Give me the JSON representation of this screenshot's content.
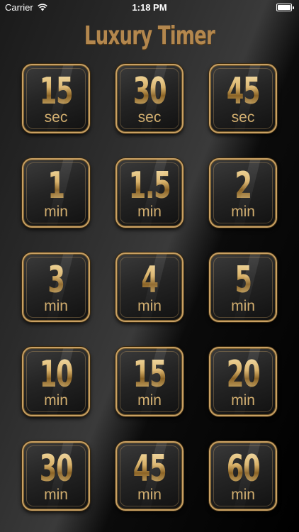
{
  "status_bar": {
    "carrier": "Carrier",
    "time": "1:18 PM"
  },
  "app": {
    "title": "Luxury Timer"
  },
  "colors": {
    "gold": "#c9a063",
    "gold_text": "#b3874e",
    "background": "#000000"
  },
  "timers": [
    {
      "value": "15",
      "unit": "sec"
    },
    {
      "value": "30",
      "unit": "sec"
    },
    {
      "value": "45",
      "unit": "sec"
    },
    {
      "value": "1",
      "unit": "min"
    },
    {
      "value": "1.5",
      "unit": "min"
    },
    {
      "value": "2",
      "unit": "min"
    },
    {
      "value": "3",
      "unit": "min"
    },
    {
      "value": "4",
      "unit": "min"
    },
    {
      "value": "5",
      "unit": "min"
    },
    {
      "value": "10",
      "unit": "min"
    },
    {
      "value": "15",
      "unit": "min"
    },
    {
      "value": "20",
      "unit": "min"
    },
    {
      "value": "30",
      "unit": "min"
    },
    {
      "value": "45",
      "unit": "min"
    },
    {
      "value": "60",
      "unit": "min"
    }
  ]
}
